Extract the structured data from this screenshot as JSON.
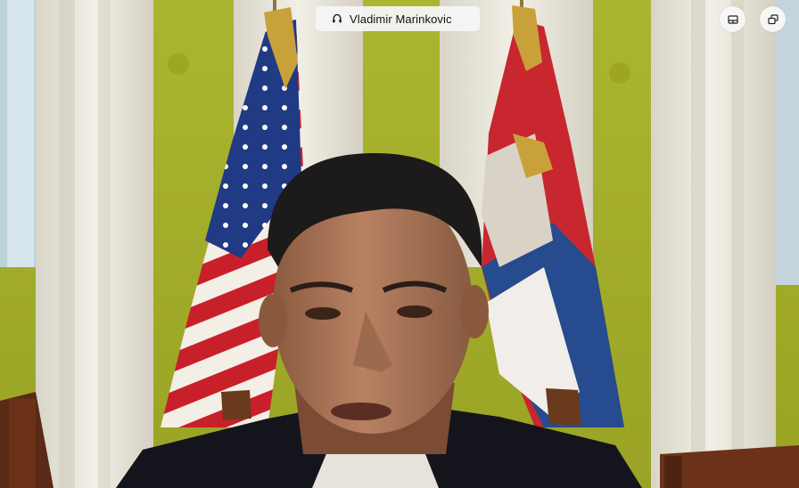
{
  "participant": {
    "name": "Vladimir Marinkovic",
    "audio_icon": "headphones-icon"
  },
  "controls": {
    "view_icon": "gallery-view-icon",
    "popout_icon": "pop-out-window-icon"
  },
  "colors": {
    "pill_background": "#f5f5f5",
    "wall_green": "#a3ae2a",
    "column_white": "#e8e4d8"
  }
}
